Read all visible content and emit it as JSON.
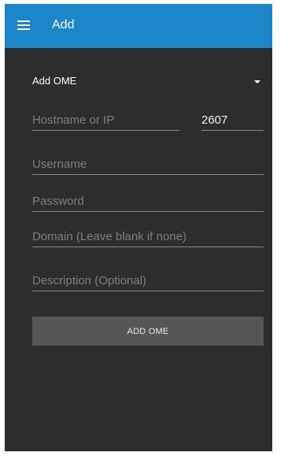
{
  "header": {
    "title": "Add",
    "menu_icon": "hamburger-menu-icon",
    "background": "#1b86c9"
  },
  "form": {
    "selector_label": "Add OME",
    "selector_icon": "dropdown-arrow-icon",
    "hostname_placeholder": "Hostname or IP",
    "port_value": "2607",
    "username_placeholder": "Username",
    "password_placeholder": "Password",
    "domain_placeholder": "Domain (Leave blank if none)",
    "description_placeholder": "Description (Optional)",
    "submit_label": "ADD OME"
  },
  "colors": {
    "screen_background": "#2d2d2d",
    "button_background": "#565656"
  }
}
